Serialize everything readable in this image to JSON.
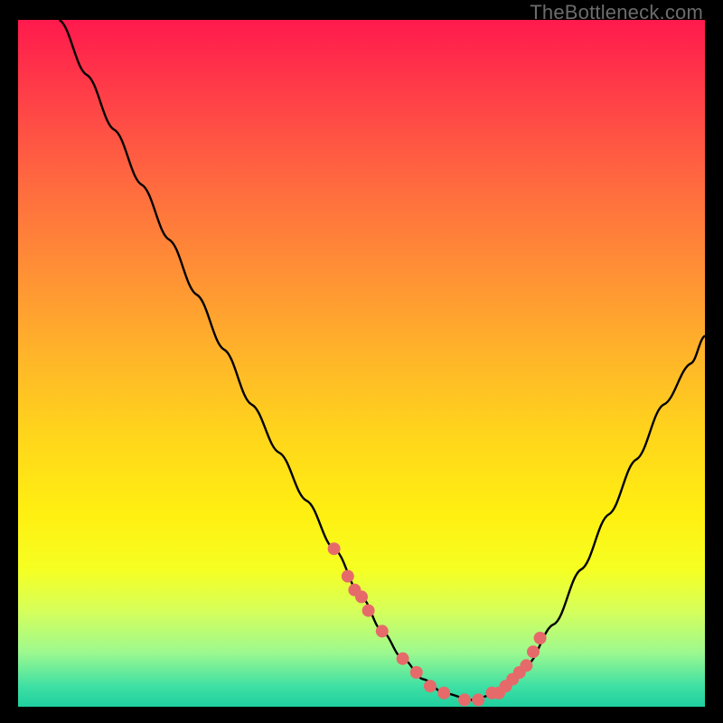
{
  "watermark": "TheBottleneck.com",
  "colors": {
    "background": "#000000",
    "curve": "#000000",
    "dot": "#e66a6a",
    "gradient_stops": [
      "#ff1a4d",
      "#ff2e4a",
      "#ff4946",
      "#ff6a3f",
      "#ff8e36",
      "#ffb22a",
      "#ffd41c",
      "#fff011",
      "#f6ff22",
      "#d6ff5a",
      "#9ef98e",
      "#3fe0a4",
      "#1fcf9f"
    ]
  },
  "chart_data": {
    "type": "line",
    "title": "",
    "xlabel": "",
    "ylabel": "",
    "xlim": [
      0,
      100
    ],
    "ylim": [
      0,
      100
    ],
    "series": [
      {
        "name": "bottleneck-curve",
        "x": [
          6,
          10,
          14,
          18,
          22,
          26,
          30,
          34,
          38,
          42,
          46,
          50,
          53,
          56,
          59,
          62,
          66,
          70,
          74,
          78,
          82,
          86,
          90,
          94,
          98,
          100
        ],
        "values": [
          100,
          92,
          84,
          76,
          68,
          60,
          52,
          44,
          37,
          30,
          23,
          16,
          11,
          7,
          4,
          2,
          1,
          2,
          6,
          12,
          20,
          28,
          36,
          44,
          50,
          54
        ]
      }
    ],
    "annotations": {
      "name": "highlight-dots",
      "x": [
        46,
        48,
        49,
        50,
        51,
        53,
        56,
        58,
        60,
        62,
        65,
        67,
        69,
        70,
        71,
        72,
        73,
        74,
        75,
        76
      ],
      "values": [
        23,
        19,
        17,
        16,
        14,
        11,
        7,
        5,
        3,
        2,
        1,
        1,
        2,
        2,
        3,
        4,
        5,
        6,
        8,
        10
      ]
    }
  }
}
